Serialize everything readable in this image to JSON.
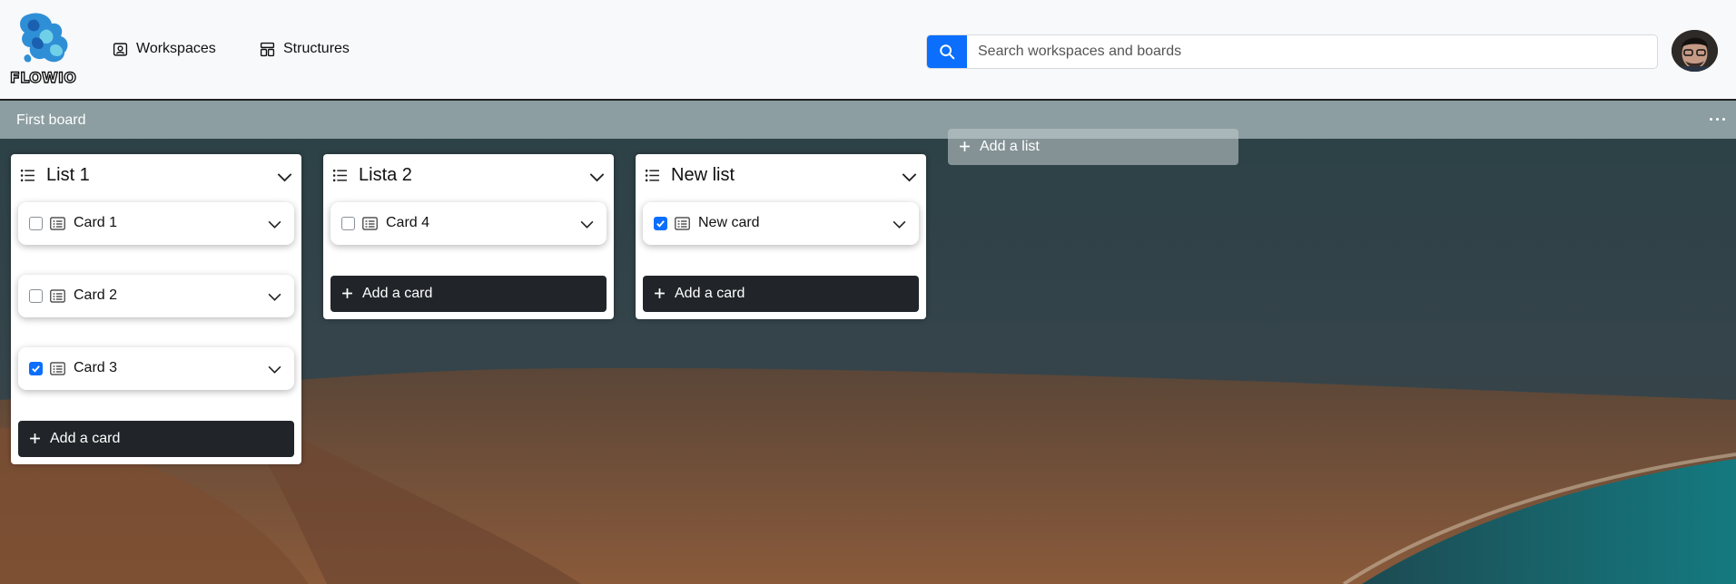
{
  "app": {
    "logo_text": "FLOWIO"
  },
  "nav": {
    "workspaces_label": "Workspaces",
    "structures_label": "Structures"
  },
  "search": {
    "placeholder": "Search workspaces and boards"
  },
  "board": {
    "title": "First board",
    "add_list_label": "Add a list"
  },
  "lists": [
    {
      "title": "List 1",
      "cards": [
        {
          "title": "Card 1",
          "checked": false
        },
        {
          "title": "Card 2",
          "checked": false
        },
        {
          "title": "Card 3",
          "checked": true
        }
      ],
      "add_card_label": "Add a card"
    },
    {
      "title": "Lista 2",
      "cards": [
        {
          "title": "Card 4",
          "checked": false
        }
      ],
      "add_card_label": "Add a card"
    },
    {
      "title": "New list",
      "cards": [
        {
          "title": "New card",
          "checked": true
        }
      ],
      "add_card_label": "Add a card"
    }
  ],
  "icons": {
    "search": "search-icon",
    "workspaces": "person-badge-icon",
    "structures": "layout-icon",
    "list": "list-icon",
    "card": "card-text-icon",
    "chevron": "chevron-down-icon",
    "plus": "plus-icon",
    "menu": "more-horizontal-icon"
  },
  "colors": {
    "accent": "#0b6efd",
    "dark_button": "#212529",
    "header_bg": "#f8f9fb"
  }
}
